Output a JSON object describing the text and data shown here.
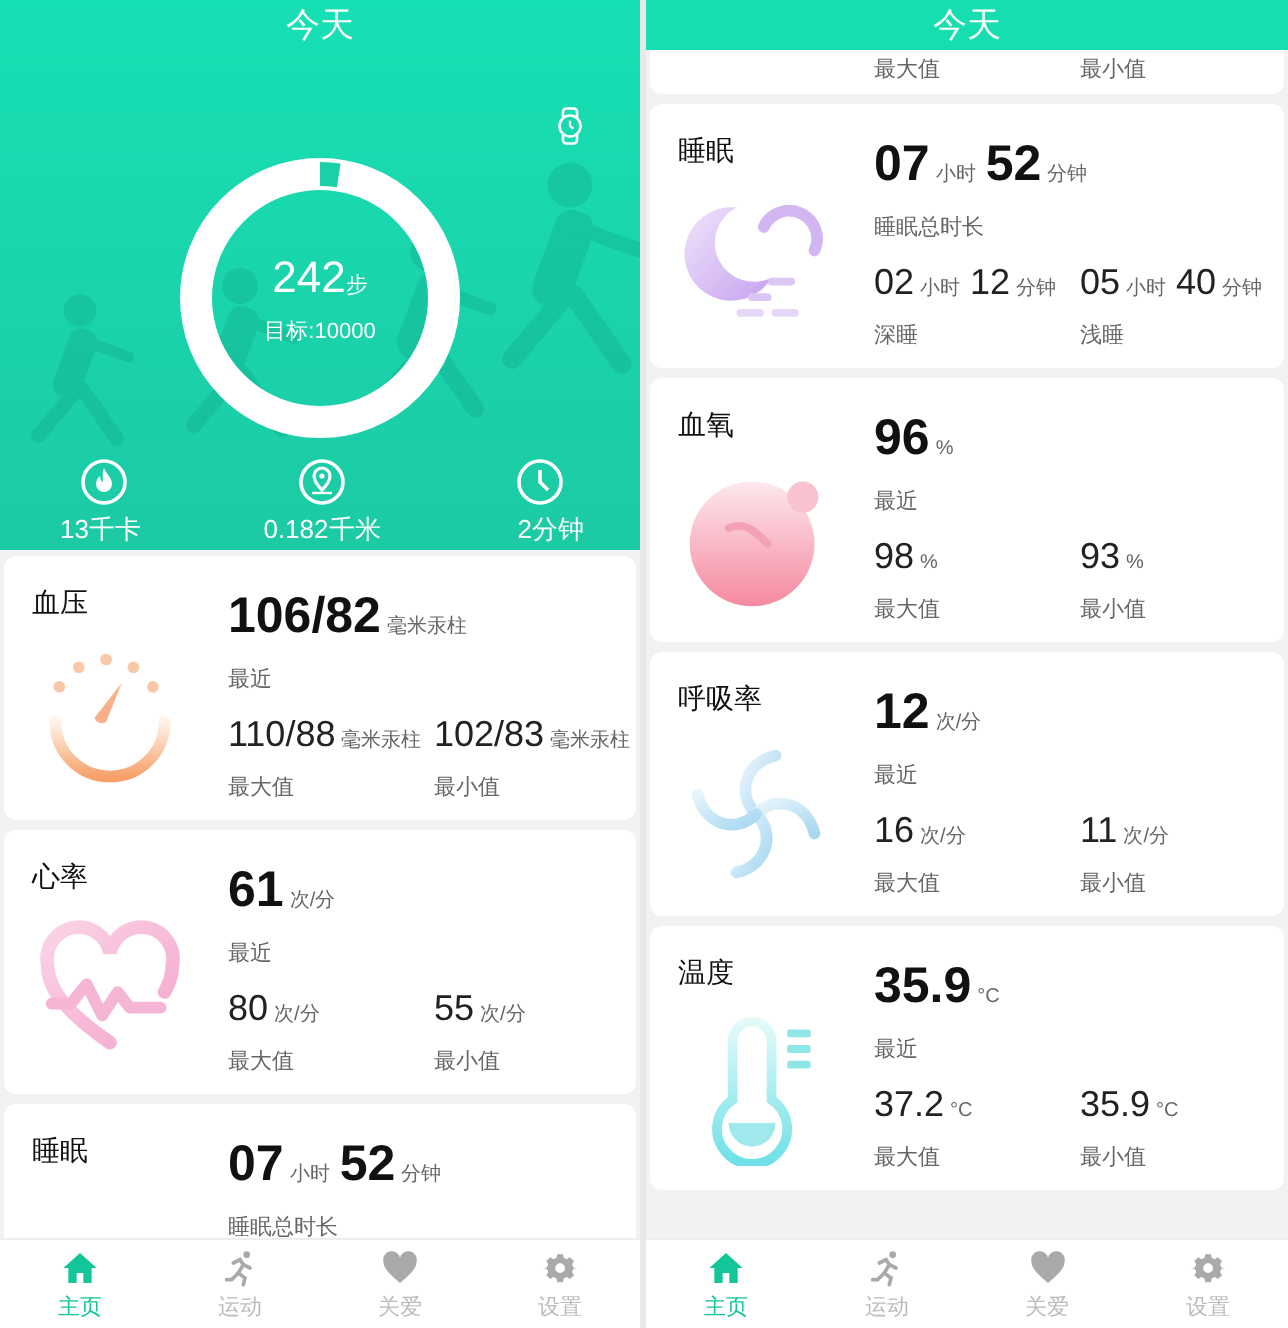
{
  "screens": [
    {
      "title": "今天",
      "summary": {
        "steps": "242",
        "steps_unit": "步",
        "goal": "目标:10000",
        "level": 0.0242,
        "stats": [
          {
            "kind": "calories",
            "value": "13千卡"
          },
          {
            "kind": "distance",
            "value": "0.182千米"
          },
          {
            "kind": "duration",
            "value": "2分钟"
          }
        ]
      },
      "cards": [
        {
          "kind": "blood_pressure",
          "title": "血压",
          "main": [
            {
              "value": "106/82",
              "unit": "毫米汞柱"
            }
          ],
          "main_label": "最近",
          "stats": [
            {
              "parts": [
                {
                  "value": "110/88",
                  "unit": "毫米汞柱"
                }
              ],
              "label": "最大值"
            },
            {
              "parts": [
                {
                  "value": "102/83",
                  "unit": "毫米汞柱"
                }
              ],
              "label": "最小值"
            }
          ]
        },
        {
          "kind": "heart_rate",
          "title": "心率",
          "main": [
            {
              "value": "61",
              "unit": "次/分"
            }
          ],
          "main_label": "最近",
          "stats": [
            {
              "parts": [
                {
                  "value": "80",
                  "unit": "次/分"
                }
              ],
              "label": "最大值"
            },
            {
              "parts": [
                {
                  "value": "55",
                  "unit": "次/分"
                }
              ],
              "label": "最小值"
            }
          ]
        },
        {
          "kind": "sleep",
          "title": "睡眠",
          "main": [
            {
              "value": "07",
              "unit": "小时"
            },
            {
              "value": "52",
              "unit": "分钟"
            }
          ],
          "main_label": "睡眠总时长"
        }
      ],
      "tabs": [
        {
          "kind": "home",
          "label": "主页",
          "selected": true
        },
        {
          "kind": "sport",
          "label": "运动",
          "selected": false
        },
        {
          "kind": "care",
          "label": "关爱",
          "selected": false
        },
        {
          "kind": "settings",
          "label": "设置",
          "selected": false
        }
      ]
    },
    {
      "title": "今天",
      "cards": [
        {
          "kind": "partial",
          "stats": [
            {
              "label": "最大值"
            },
            {
              "label": "最小值"
            }
          ]
        },
        {
          "kind": "sleep",
          "title": "睡眠",
          "main": [
            {
              "value": "07",
              "unit": "小时"
            },
            {
              "value": "52",
              "unit": "分钟"
            }
          ],
          "main_label": "睡眠总时长",
          "stats": [
            {
              "parts": [
                {
                  "value": "02",
                  "unit": "小时"
                },
                {
                  "value": "12",
                  "unit": "分钟"
                }
              ],
              "label": "深睡"
            },
            {
              "parts": [
                {
                  "value": "05",
                  "unit": "小时"
                },
                {
                  "value": "40",
                  "unit": "分钟"
                }
              ],
              "label": "浅睡"
            }
          ]
        },
        {
          "kind": "blood_oxygen",
          "title": "血氧",
          "main": [
            {
              "value": "96",
              "unit": "%"
            }
          ],
          "main_label": "最近",
          "stats": [
            {
              "parts": [
                {
                  "value": "98",
                  "unit": "%"
                }
              ],
              "label": "最大值"
            },
            {
              "parts": [
                {
                  "value": "93",
                  "unit": "%"
                }
              ],
              "label": "最小值"
            }
          ]
        },
        {
          "kind": "respiration",
          "title": "呼吸率",
          "main": [
            {
              "value": "12",
              "unit": "次/分"
            }
          ],
          "main_label": "最近",
          "stats": [
            {
              "parts": [
                {
                  "value": "16",
                  "unit": "次/分"
                }
              ],
              "label": "最大值"
            },
            {
              "parts": [
                {
                  "value": "11",
                  "unit": "次/分"
                }
              ],
              "label": "最小值"
            }
          ]
        },
        {
          "kind": "temperature",
          "title": "温度",
          "main": [
            {
              "value": "35.9",
              "unit": "°C"
            }
          ],
          "main_label": "最近",
          "stats": [
            {
              "parts": [
                {
                  "value": "37.2",
                  "unit": "°C"
                }
              ],
              "label": "最大值"
            },
            {
              "parts": [
                {
                  "value": "35.9",
                  "unit": "°C"
                }
              ],
              "label": "最小值"
            }
          ]
        }
      ],
      "tabs": [
        {
          "kind": "home",
          "label": "主页",
          "selected": true
        },
        {
          "kind": "sport",
          "label": "运动",
          "selected": false
        },
        {
          "kind": "care",
          "label": "关爱",
          "selected": false
        },
        {
          "kind": "settings",
          "label": "设置",
          "selected": false
        }
      ]
    }
  ]
}
